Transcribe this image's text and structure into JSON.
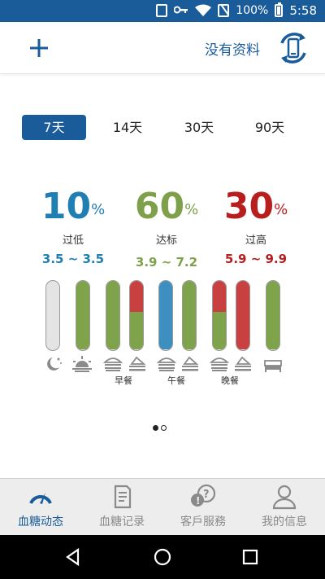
{
  "status_bar": {
    "battery": "100%",
    "time": "5:58",
    "icons": [
      "vibrate-icon",
      "key-icon",
      "wifi-icon",
      "no-sim-icon",
      "battery-icon"
    ]
  },
  "header": {
    "add_icon": "plus-icon",
    "no_data_label": "没有资料",
    "sync_icon": "phone-sync-icon"
  },
  "range_tabs": [
    {
      "label": "7天",
      "active": true
    },
    {
      "label": "14天",
      "active": false
    },
    {
      "label": "30天",
      "active": false
    },
    {
      "label": "90天",
      "active": false
    }
  ],
  "stats": [
    {
      "percent": "10",
      "unit": "%",
      "label": "过低",
      "range": "3.5 ~ 3.5",
      "color": "#1f7fb3"
    },
    {
      "percent": "60",
      "unit": "%",
      "label": "达标",
      "range": "3.9 ~ 7.2",
      "color": "#7fa04a"
    },
    {
      "percent": "30",
      "unit": "%",
      "label": "过高",
      "range": "5.9 ~ 9.9",
      "color": "#b81e1e"
    }
  ],
  "colors": {
    "brand": "#1a5b9a",
    "low": "#3d8fc0",
    "target": "#7ea34b",
    "high": "#c94040",
    "empty": "#e4e4e4"
  },
  "bars": [
    {
      "slot": "night",
      "icon": "moon-icon",
      "low": 0,
      "target": 0,
      "high": 0
    },
    {
      "slot": "morning",
      "icon": "sunrise-icon",
      "low": 0,
      "target": 1,
      "high": 0
    },
    {
      "slot": "breakfast-before",
      "icon": "meal-before-icon",
      "low": 0,
      "target": 1,
      "high": 0
    },
    {
      "slot": "breakfast-after",
      "icon": "meal-after-icon",
      "low": 0,
      "target": 0.55,
      "high": 0.45
    },
    {
      "slot": "lunch-before",
      "icon": "meal-before-icon",
      "low": 1,
      "target": 0,
      "high": 0
    },
    {
      "slot": "lunch-after",
      "icon": "meal-after-icon",
      "low": 0,
      "target": 1,
      "high": 0
    },
    {
      "slot": "dinner-before",
      "icon": "meal-before-icon",
      "low": 0,
      "target": 0.55,
      "high": 0.45
    },
    {
      "slot": "dinner-after",
      "icon": "meal-after-icon",
      "low": 0,
      "target": 0,
      "high": 1
    },
    {
      "slot": "bedtime",
      "icon": "bed-icon",
      "low": 0,
      "target": 1,
      "high": 0
    }
  ],
  "meal_labels": [
    "早餐",
    "午餐",
    "晚餐"
  ],
  "pager": {
    "pages": 2,
    "current": 1
  },
  "bottom_nav": [
    {
      "label": "血糖动态",
      "icon": "gauge-icon",
      "active": true
    },
    {
      "label": "血糖记录",
      "icon": "logbook-icon",
      "active": false
    },
    {
      "label": "客戶服務",
      "icon": "support-icon",
      "active": false
    },
    {
      "label": "我的信息",
      "icon": "profile-icon",
      "active": false
    }
  ],
  "system_nav": [
    "back-icon",
    "home-icon",
    "recents-icon"
  ]
}
